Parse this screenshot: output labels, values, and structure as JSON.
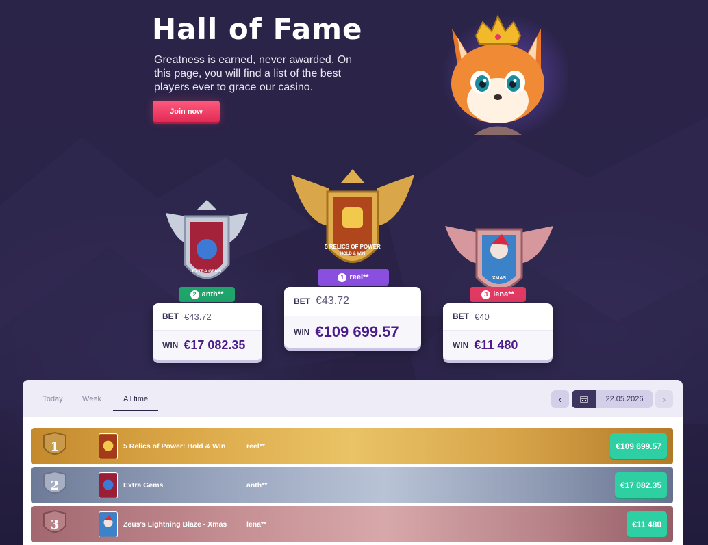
{
  "hero": {
    "title": "Hall of Fame",
    "description": "Greatness is earned, never awarded. On this page, you will find a list of the best players ever to grace our casino.",
    "join_label": "Join now"
  },
  "podium": [
    {
      "rank": "2",
      "player": "anth**",
      "game_art": "EXTRA GEMS",
      "bet_label": "BET",
      "bet": "€43.72",
      "win_label": "WIN",
      "win": "€17 082.35",
      "color": "#1fa56b"
    },
    {
      "rank": "1",
      "player": "reel**",
      "game_art": "5 RELICS OF POWER",
      "game_art_sub": "HOLD & WIN",
      "bet_label": "BET",
      "bet": "€43.72",
      "win_label": "WIN",
      "win": "€109 699.57",
      "color": "#8b4fe0"
    },
    {
      "rank": "3",
      "player": "lena**",
      "game_art": "XMAS",
      "bet_label": "BET",
      "bet": "€40",
      "win_label": "WIN",
      "win": "€11 480",
      "color": "#e03a62"
    }
  ],
  "tabs": [
    {
      "label": "Today",
      "active": false
    },
    {
      "label": "Week",
      "active": false
    },
    {
      "label": "All time",
      "active": true
    }
  ],
  "date": "22.05.2026",
  "leaderboard": [
    {
      "rank": "1",
      "game": "5 Relics of Power: Hold & Win",
      "player": "reel**",
      "amount": "€109 699.57",
      "tier": "gold"
    },
    {
      "rank": "2",
      "game": "Extra Gems",
      "player": "anth**",
      "amount": "€17 082.35",
      "tier": "silver"
    },
    {
      "rank": "3",
      "game": "Zeus's Lightning Blaze - Xmas",
      "player": "lena**",
      "amount": "€11 480",
      "tier": "bronze"
    }
  ]
}
